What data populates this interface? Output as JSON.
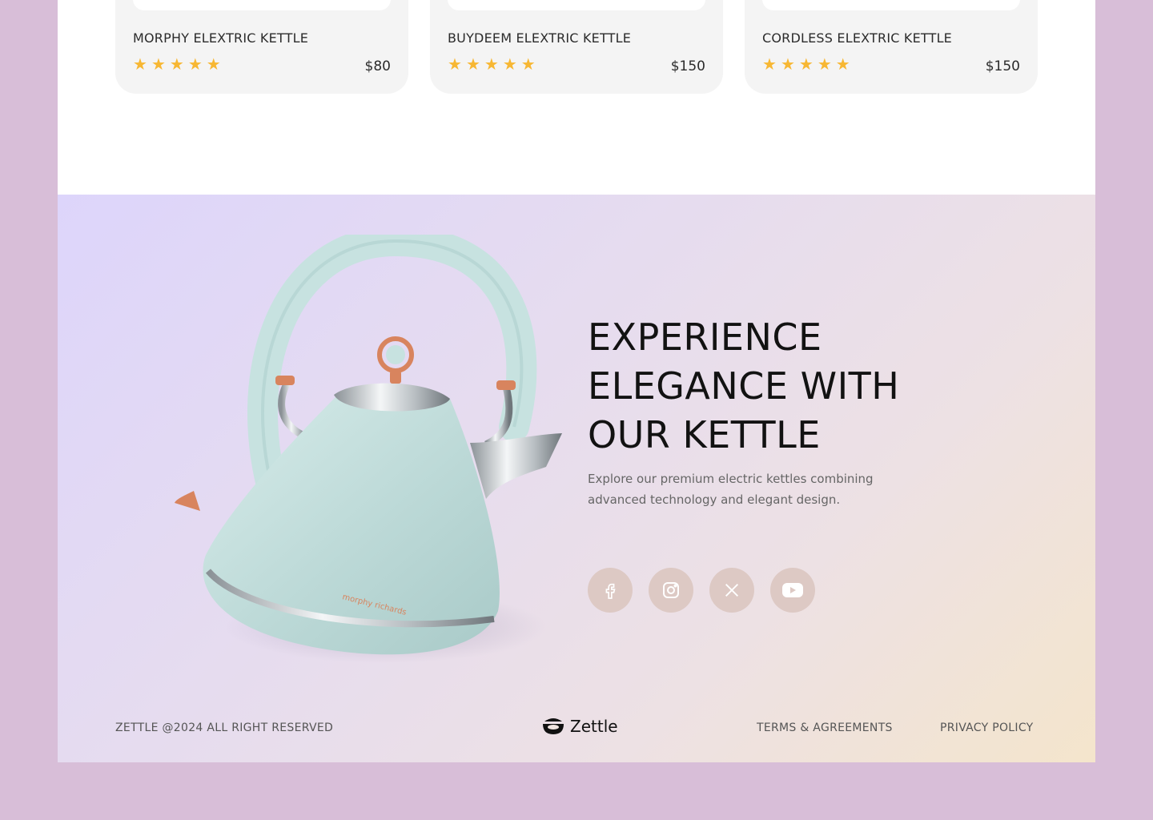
{
  "products": [
    {
      "name": "MORPHY ELEXTRIC KETTLE",
      "price": "$80",
      "rating": 5
    },
    {
      "name": "BUYDEEM ELEXTRIC KETTLE",
      "price": "$150",
      "rating": 5
    },
    {
      "name": "CORDLESS ELEXTRIC KETTLE",
      "price": "$150",
      "rating": 5
    }
  ],
  "hero": {
    "headline": [
      "EXPERIENCE",
      "ELEGANCE WITH",
      "OUR KETTLE"
    ],
    "subtext": "Explore our premium electric kettles combining advanced technology and elegant design.",
    "kettle_brand": "morphy richards"
  },
  "social": [
    "facebook-icon",
    "instagram-icon",
    "x-icon",
    "youtube-icon"
  ],
  "footer": {
    "copyright": "ZETTLE @2024 ALL RIGHT RESERVED",
    "logo": "Zettle",
    "terms": "TERMS & AGREEMENTS",
    "privacy": "PRIVACY POLICY"
  },
  "colors": {
    "page_bg": "#d8bed8",
    "star": "#f7b733",
    "social_bg": "#ddc9c4",
    "kettle": "#c5e0df",
    "copper": "#d8845e"
  }
}
